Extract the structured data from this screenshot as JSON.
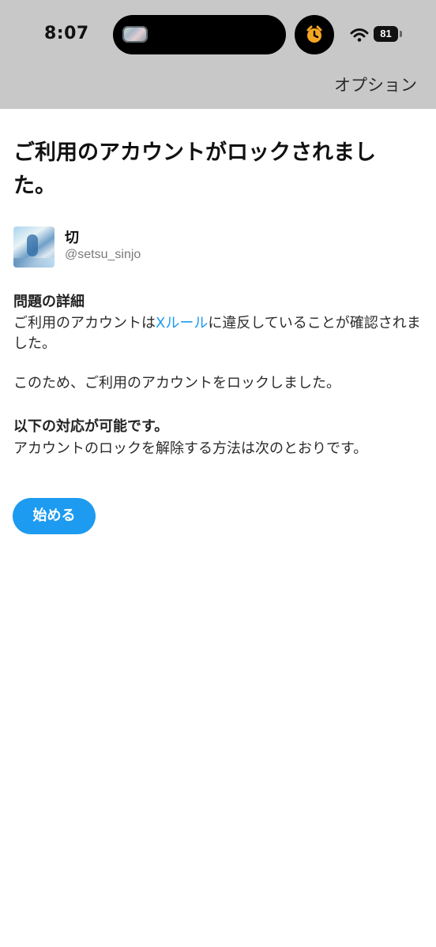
{
  "status_bar": {
    "time": "8:07",
    "battery_level": "81",
    "icons": [
      "music-thumbnail-icon",
      "alarm-icon",
      "wifi-icon",
      "battery-icon"
    ]
  },
  "header": {
    "options_label": "オプション"
  },
  "page": {
    "title": "ご利用のアカウントがロックされました。"
  },
  "account": {
    "display_name": "切",
    "handle": "@setsu_sinjo"
  },
  "details": {
    "heading": "問題の詳細",
    "paragraph_1_before": "ご利用のアカウントは",
    "rules_link": "Xルール",
    "paragraph_1_after": "に違反していることが確認されました。",
    "paragraph_2": "このため、ご利用のアカウントをロックしました。"
  },
  "actions": {
    "heading": "以下の対応が可能です。",
    "description": "アカウントのロックを解除する方法は次のとおりです。",
    "start_button": "始める"
  },
  "colors": {
    "accent": "#1d9bf0",
    "status_bar_background": "#c8c8c8",
    "alarm": "#f5a623"
  }
}
